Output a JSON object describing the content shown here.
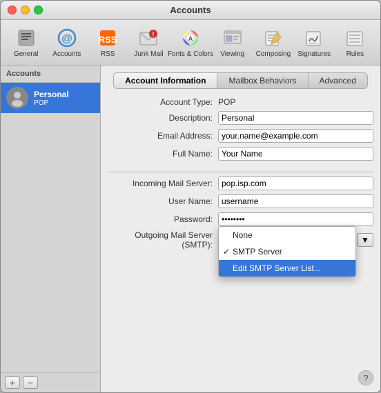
{
  "window": {
    "title": "Accounts"
  },
  "toolbar": {
    "items": [
      {
        "id": "general",
        "label": "General",
        "icon": "⚙"
      },
      {
        "id": "accounts",
        "label": "Accounts",
        "icon": "@"
      },
      {
        "id": "rss",
        "label": "RSS",
        "icon": "RSS"
      },
      {
        "id": "junk-mail",
        "label": "Junk Mail",
        "icon": "🚫"
      },
      {
        "id": "fonts-colors",
        "label": "Fonts & Colors",
        "icon": "A"
      },
      {
        "id": "viewing",
        "label": "Viewing",
        "icon": "👁"
      },
      {
        "id": "composing",
        "label": "Composing",
        "icon": "✏"
      },
      {
        "id": "signatures",
        "label": "Signatures",
        "icon": "✒"
      },
      {
        "id": "rules",
        "label": "Rules",
        "icon": "☰"
      }
    ]
  },
  "sidebar": {
    "title": "Accounts",
    "accounts": [
      {
        "name": "Personal",
        "type": "POP"
      }
    ],
    "add_button": "+",
    "remove_button": "−"
  },
  "tabs": [
    {
      "id": "account-information",
      "label": "Account Information",
      "active": true
    },
    {
      "id": "mailbox-behaviors",
      "label": "Mailbox Behaviors",
      "active": false
    },
    {
      "id": "advanced",
      "label": "Advanced",
      "active": false
    }
  ],
  "form": {
    "account_type_label": "Account Type:",
    "account_type_value": "POP",
    "description_label": "Description:",
    "description_value": "Personal",
    "email_label": "Email Address:",
    "email_value": "your.name@example.com",
    "fullname_label": "Full Name:",
    "fullname_value": "Your Name",
    "incoming_label": "Incoming Mail Server:",
    "incoming_value": "pop.isp.com",
    "username_label": "User Name:",
    "username_value": "username",
    "password_label": "Password:",
    "password_value": "••••••••",
    "outgoing_label": "Outgoing Mail Server (SMTP):",
    "outgoing_placeholder": ""
  },
  "dropdown": {
    "items": [
      {
        "id": "none",
        "label": "None",
        "checked": false,
        "highlighted": false
      },
      {
        "id": "smtp-server",
        "label": "SMTP Server",
        "checked": true,
        "highlighted": false
      },
      {
        "id": "edit-smtp",
        "label": "Edit SMTP Server List...",
        "checked": false,
        "highlighted": true
      }
    ]
  },
  "help": "?"
}
